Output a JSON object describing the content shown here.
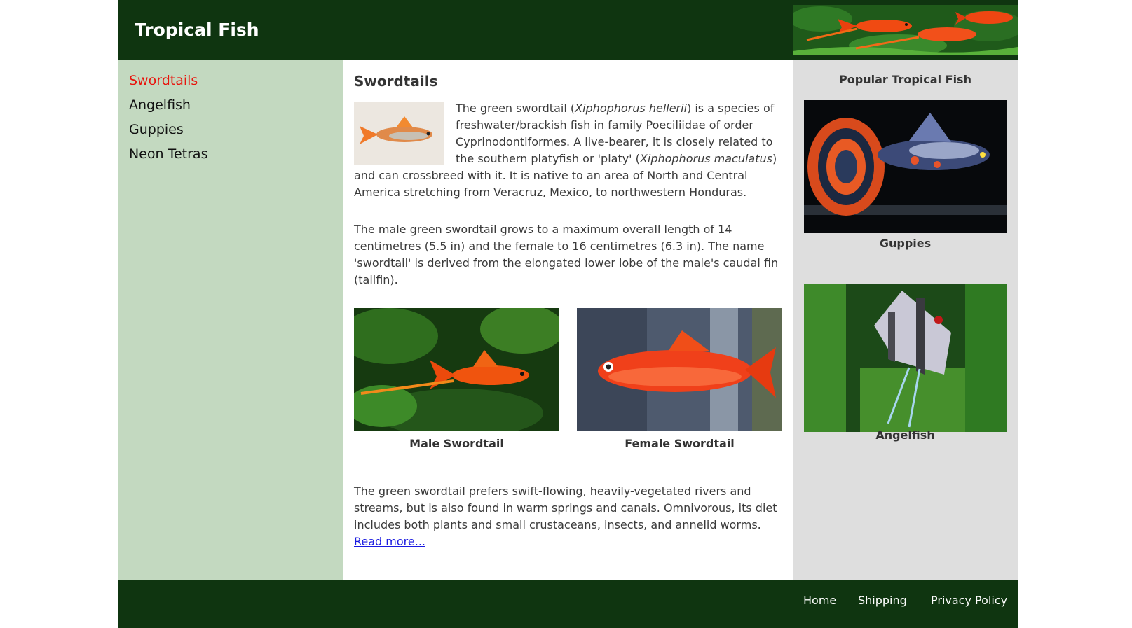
{
  "header": {
    "site_title": "Tropical Fish"
  },
  "nav": {
    "items": [
      {
        "label": "Swordtails",
        "active": true
      },
      {
        "label": "Angelfish",
        "active": false
      },
      {
        "label": "Guppies",
        "active": false
      },
      {
        "label": "Neon Tetras",
        "active": false
      }
    ]
  },
  "main": {
    "heading": "Swordtails",
    "intro": {
      "t1": "The green swordtail (",
      "sci1": "Xiphophorus hellerii",
      "t2": ") is a species of freshwater/brackish fish in family Poeciliidae of order Cyprinodontiformes. A live-bearer, it is closely related to the southern platyfish or 'platy' (",
      "sci2": "Xiphophorus maculatus",
      "t3": ") and can crossbreed with it. It is native to an area of North and Central America stretching from Veracruz, Mexico, to northwestern Honduras."
    },
    "para2": "The male green swordtail grows to a maximum overall length of 14 centimetres (5.5 in) and the female to 16 centimetres (6.3 in). The name 'swordtail' is derived from the elongated lower lobe of the male's caudal fin (tailfin).",
    "figures": [
      {
        "caption": "Male Swordtail"
      },
      {
        "caption": "Female Swordtail"
      }
    ],
    "para3": "The green swordtail prefers swift-flowing, heavily-vegetated rivers and streams, but is also found in warm springs and canals. Omnivorous, its diet includes both plants and small crustaceans, insects, and annelid worms. ",
    "read_more": "Read more..."
  },
  "aside": {
    "title": "Popular Tropical Fish",
    "items": [
      {
        "caption": "Guppies"
      },
      {
        "caption": "Angelfish"
      }
    ]
  },
  "footer": {
    "links": [
      "Home",
      "Shipping",
      "Privacy Policy"
    ]
  },
  "colors": {
    "header_bg": "#0f3510",
    "sidebar_bg": "#c3d9c0",
    "aside_bg": "#dedede",
    "active_nav": "#e8140c",
    "link": "#1a1ae0"
  },
  "icons": [
    "swordtail-thumbnail-image",
    "male-swordtail-image",
    "female-swordtail-image",
    "guppy-image",
    "angelfish-image",
    "header-banner-image"
  ]
}
